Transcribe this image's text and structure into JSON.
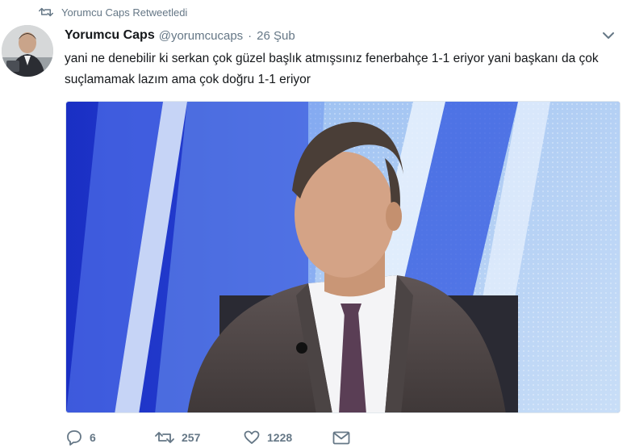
{
  "retweet_context": {
    "label": "Yorumcu Caps Retweetledi"
  },
  "tweet": {
    "display_name": "Yorumcu Caps",
    "handle": "@yorumcucaps",
    "separator": "·",
    "date": "26 Şub",
    "text": "yani ne denebilir ki serkan çok güzel başlık atmışsınız fenerbahçe 1-1 eriyor yani başkanı da çok suçlamamak lazım ama çok doğru 1-1 eriyor"
  },
  "actions": {
    "reply_count": "6",
    "retweet_count": "257",
    "like_count": "1228"
  },
  "colors": {
    "secondary_text": "#657786",
    "primary_text": "#14171a",
    "studio_blue": "#1f3fd8"
  },
  "icons": [
    "retweet-icon",
    "caret-down-icon",
    "reply-icon",
    "retweet-icon",
    "heart-icon",
    "mail-icon"
  ]
}
